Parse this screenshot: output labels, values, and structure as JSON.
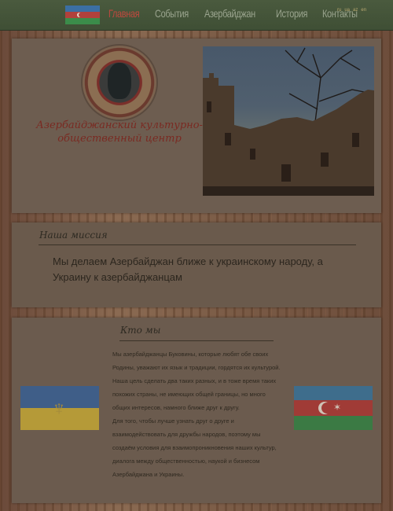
{
  "nav": {
    "items": [
      "Главная",
      "События",
      "Азербайджан",
      "История",
      "Контакты"
    ],
    "languages": [
      "ru",
      "ua",
      "az",
      "en"
    ]
  },
  "hero": {
    "title": "Азербайджанский культурно-общественный центр"
  },
  "mission": {
    "title": "Наша миссия",
    "text": "Мы делаем Азербайджан ближе к украинскому народу, а Украину к азербайджанцам"
  },
  "about": {
    "title": "Кто мы",
    "paragraphs": [
      "Мы азербайджанцы Буковины, которые любят обе своих Родины, уважают их язык и традиции, гордятся их культурой.",
      "Наша цель сделать два таких разных, и в тоже время таких похожих страны, не имеющих общей границы, но много общих интересов, намного ближе друг к другу.",
      "Для того, чтобы лучше узнать друг о друге и взаимодействовать для дружбы народов, поэтому мы создаём условия для взаимопроникновения наших культур, диалога между общественностью, наукой и бизнесом Азербайджана и Украины."
    ]
  }
}
